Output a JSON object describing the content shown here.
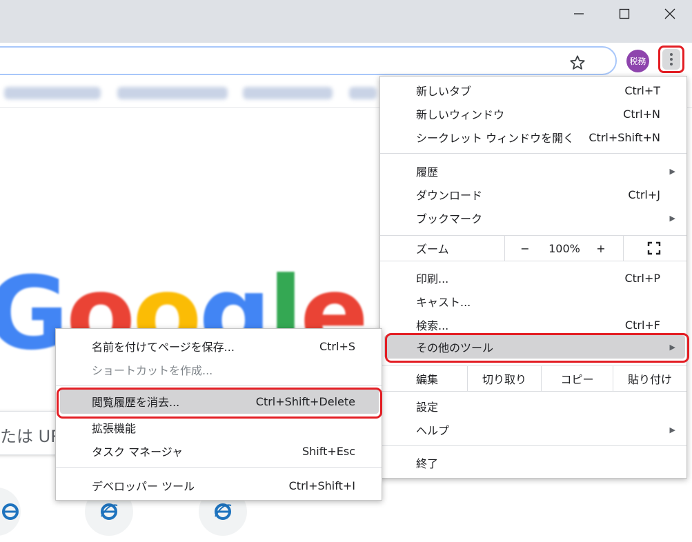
{
  "avatar_text": "税務",
  "search_partial_text": "たは UR",
  "main_menu": {
    "new_tab": {
      "label": "新しいタブ",
      "shortcut": "Ctrl+T"
    },
    "new_window": {
      "label": "新しいウィンドウ",
      "shortcut": "Ctrl+N"
    },
    "incognito": {
      "label": "シークレット ウィンドウを開く",
      "shortcut": "Ctrl+Shift+N"
    },
    "history": {
      "label": "履歴"
    },
    "downloads": {
      "label": "ダウンロード",
      "shortcut": "Ctrl+J"
    },
    "bookmarks": {
      "label": "ブックマーク"
    },
    "zoom": {
      "label": "ズーム",
      "minus": "−",
      "value": "100%",
      "plus": "+"
    },
    "print": {
      "label": "印刷...",
      "shortcut": "Ctrl+P"
    },
    "cast": {
      "label": "キャスト..."
    },
    "find": {
      "label": "検索...",
      "shortcut": "Ctrl+F"
    },
    "more_tools": {
      "label": "その他のツール"
    },
    "edit": {
      "label": "編集",
      "cut": "切り取り",
      "copy": "コピー",
      "paste": "貼り付け"
    },
    "settings": {
      "label": "設定"
    },
    "help": {
      "label": "ヘルプ"
    },
    "exit": {
      "label": "終了"
    }
  },
  "sub_menu": {
    "save_page": {
      "label": "名前を付けてページを保存...",
      "shortcut": "Ctrl+S"
    },
    "create_shortcut": {
      "label": "ショートカットを作成..."
    },
    "clear_data": {
      "label": "閲覧履歴を消去...",
      "shortcut": "Ctrl+Shift+Delete"
    },
    "extensions": {
      "label": "拡張機能"
    },
    "task_manager": {
      "label": "タスク マネージャ",
      "shortcut": "Shift+Esc"
    },
    "dev_tools": {
      "label": "デベロッパー ツール",
      "shortcut": "Ctrl+Shift+I"
    }
  },
  "colors": {
    "highlight_border": "#e31e24",
    "highlight_fill": "#d3d3d5",
    "avatar_bg": "#8e44ad"
  }
}
